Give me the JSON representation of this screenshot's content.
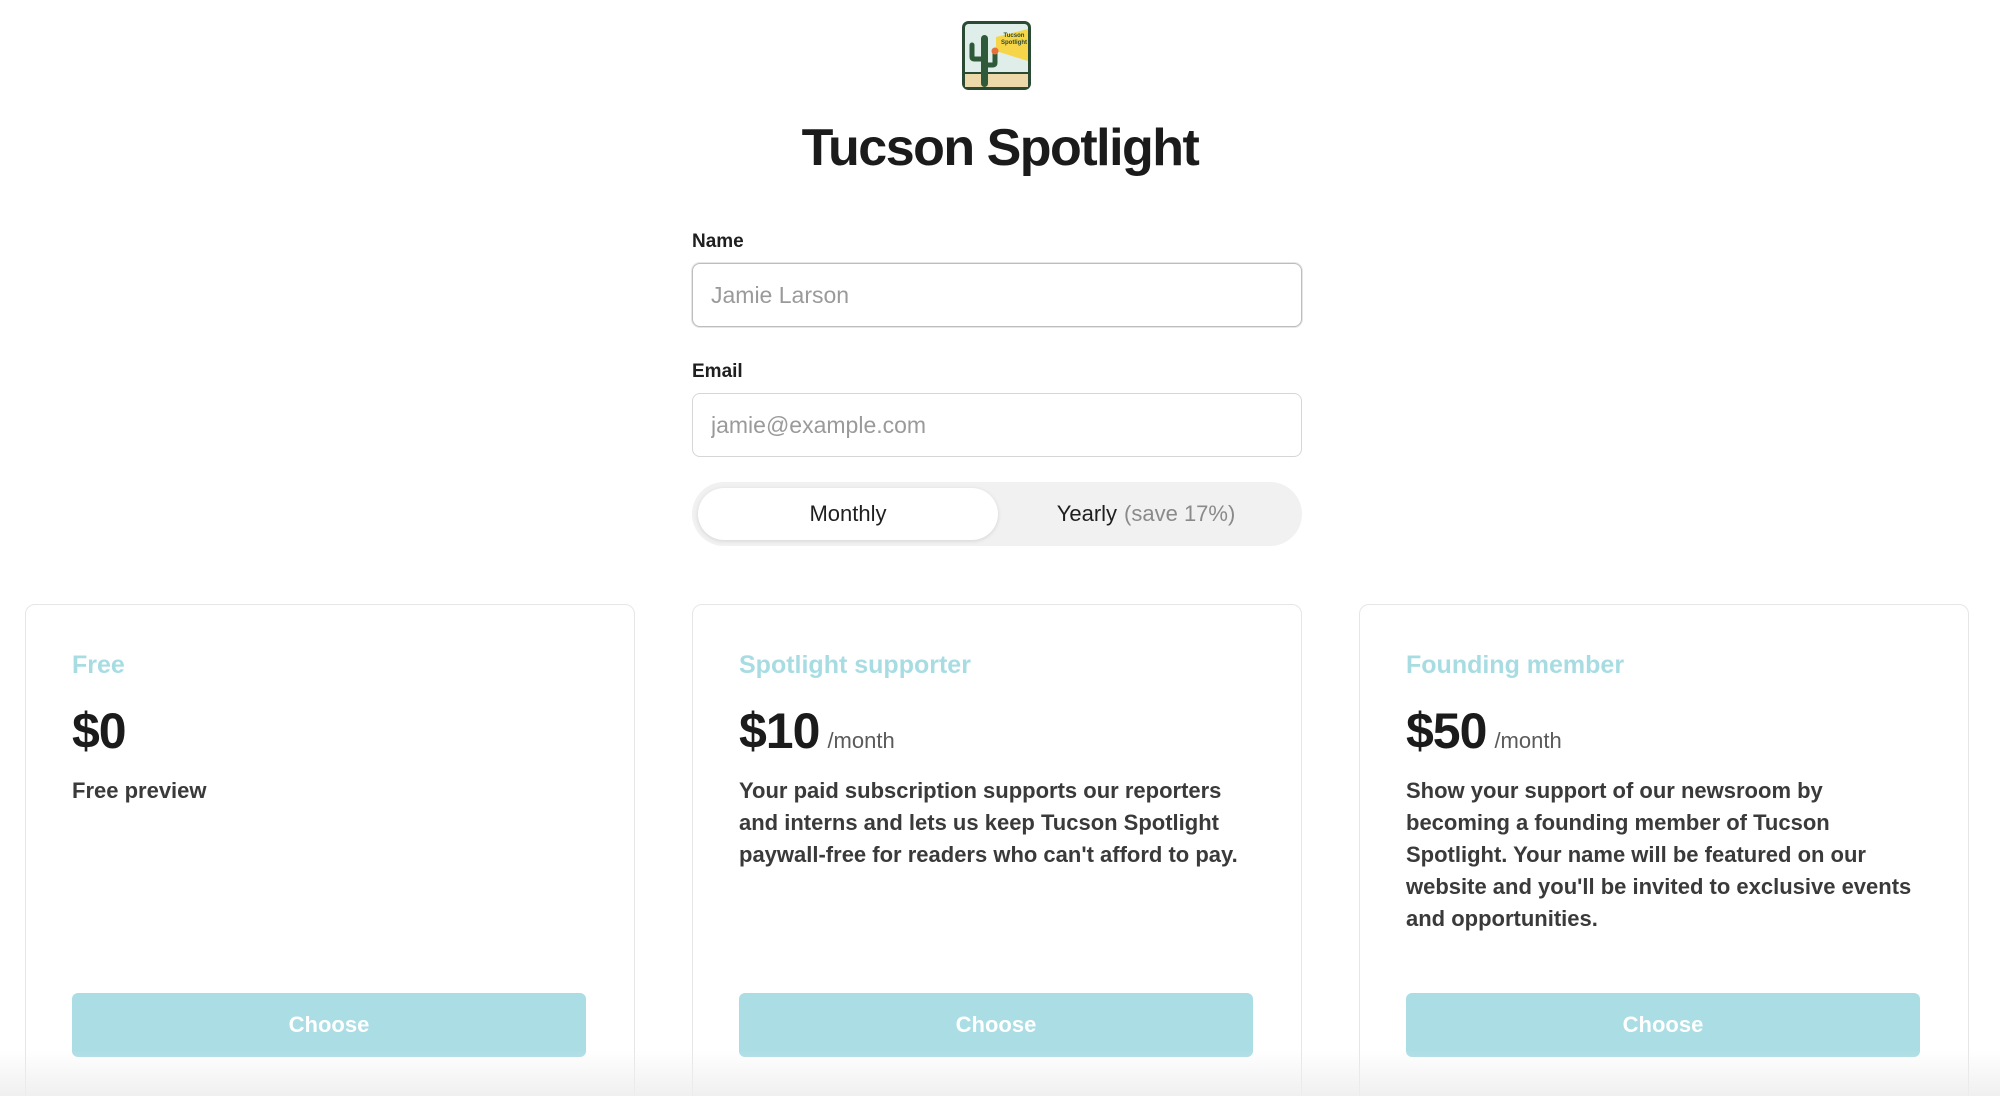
{
  "brand": {
    "title": "Tucson Spotlight",
    "logo_text_line1": "Tucson",
    "logo_text_line2": "Spotlight",
    "logo_colors": {
      "sky": "#dfeee8",
      "sun": "#f6d548",
      "cactus": "#2f5a3a",
      "ground": "#ecd8a8",
      "flower": "#e8703a",
      "border": "#2b4a33"
    }
  },
  "form": {
    "name": {
      "label": "Name",
      "placeholder": "Jamie Larson",
      "value": "",
      "focused": true
    },
    "email": {
      "label": "Email",
      "placeholder": "jamie@example.com",
      "value": ""
    }
  },
  "billing": {
    "selected": "Monthly",
    "monthly_label": "Monthly",
    "yearly_label": "Yearly",
    "yearly_savings": "(save 17%)"
  },
  "plans": [
    {
      "name": "Free",
      "price": "$0",
      "interval": "",
      "description": "Free preview",
      "button_label": "Choose"
    },
    {
      "name": "Spotlight supporter",
      "price": "$10",
      "interval": "/month",
      "description": "Your paid subscription supports our reporters and interns and lets us keep Tucson Spotlight paywall-free for readers who can't afford to pay.",
      "button_label": "Choose"
    },
    {
      "name": "Founding member",
      "price": "$50",
      "interval": "/month",
      "description": "Show your support of our newsroom by becoming a founding member of Tucson Spotlight. Your name will be featured on our website and you'll be invited to exclusive events and opportunities.",
      "button_label": "Choose"
    }
  ],
  "colors": {
    "accent": "#a8dce3",
    "button": "#abdde5",
    "toggle_track": "#f1f1f1"
  }
}
